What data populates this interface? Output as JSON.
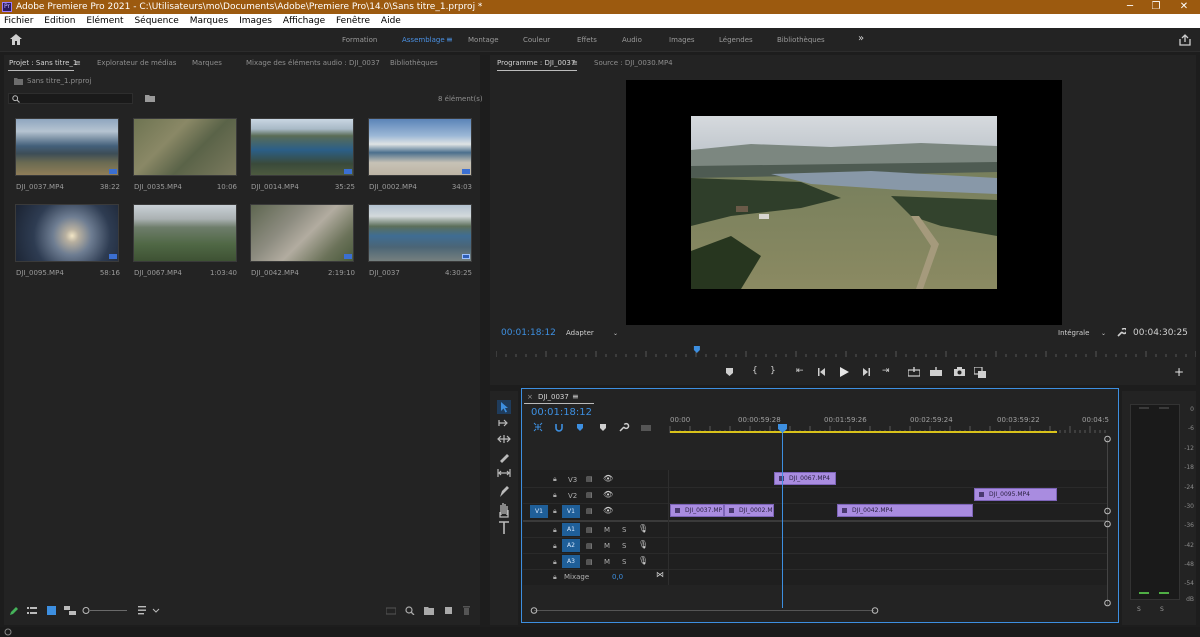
{
  "window": {
    "title": "Adobe Premiere Pro 2021 - C:\\Utilisateurs\\mo\\Documents\\Adobe\\Premiere Pro\\14.0\\Sans titre_1.prproj *",
    "app_icon": "Pr",
    "controls": {
      "minimize": "─",
      "maximize": "❐",
      "close": "✕"
    }
  },
  "menu": [
    "Fichier",
    "Edition",
    "Elément",
    "Séquence",
    "Marques",
    "Images",
    "Affichage",
    "Fenêtre",
    "Aide"
  ],
  "workspaces": {
    "items": [
      "Formation",
      "Assemblage",
      "Montage",
      "Couleur",
      "Effets",
      "Audio",
      "Images",
      "Légendes",
      "Bibliothèques"
    ],
    "active": "Assemblage",
    "active_menu_icon": "≡",
    "more_icon": "»"
  },
  "project_panel": {
    "tabs": [
      "Projet : Sans titre_1",
      "Explorateur de médias",
      "Marques",
      "Mixage des éléments audio : DJI_0037",
      "Bibliothèques"
    ],
    "tab_menu_icon": "≡",
    "project_file": "Sans titre_1.prproj",
    "search_placeholder": "",
    "item_count": "8 élément(s)",
    "clips": [
      {
        "name": "DJI_0037.MP4",
        "duration": "38:22"
      },
      {
        "name": "DJI_0035.MP4",
        "duration": "10:06"
      },
      {
        "name": "DJI_0014.MP4",
        "duration": "35:25"
      },
      {
        "name": "DJI_0002.MP4",
        "duration": "34:03"
      },
      {
        "name": "DJI_0095.MP4",
        "duration": "58:16"
      },
      {
        "name": "DJI_0067.MP4",
        "duration": "1:03:40"
      },
      {
        "name": "DJI_0042.MP4",
        "duration": "2:19:10"
      },
      {
        "name": "DJI_0037",
        "duration": "4:30:25"
      }
    ]
  },
  "program_monitor": {
    "tabs": [
      "Programme : DJI_0037",
      "Source : DJI_0030.MP4"
    ],
    "tab_menu_icon": "≡",
    "timecode": "00:01:18:12",
    "fit": "Adapter",
    "quality": "Intégrale",
    "duration": "00:04:30:25",
    "add_button": "+",
    "playhead_fraction": 0.287
  },
  "timeline": {
    "tab": "DJI_0037",
    "close_icon": "×",
    "menu_icon": "≡",
    "timecode": "00:01:18:12",
    "ruler": [
      "00:00",
      "00:00:59:28",
      "00:01:59:26",
      "00:02:59:24",
      "00:03:59:22",
      "00:04:5"
    ],
    "video_tracks": [
      "V3",
      "V2",
      "V1"
    ],
    "audio_tracks": [
      "A1",
      "A2",
      "A3"
    ],
    "source_patch_video": "V1",
    "mix_label": "Mixage",
    "mix_value": "0,0",
    "mute": "M",
    "solo": "S",
    "clips": {
      "v3": [
        "DJI_0067.MP4"
      ],
      "v2": [
        "DJI_0095.MP4"
      ],
      "v1": [
        "DJI_0037.MP",
        "DJI_0002.M",
        "DJI_0042.MP4"
      ]
    }
  },
  "audio_meter": {
    "scale": [
      "0",
      "-6",
      "-12",
      "-18",
      "-24",
      "-30",
      "-36",
      "-42",
      "-48",
      "-54",
      "dB"
    ],
    "solo_labels": [
      "S",
      "S"
    ]
  },
  "colors": {
    "accent_blue": "#3d8fe0",
    "clip_purple": "#a98ce0",
    "titlebar": "#9c5a0f",
    "work_area_yellow": "#d9c21a"
  }
}
